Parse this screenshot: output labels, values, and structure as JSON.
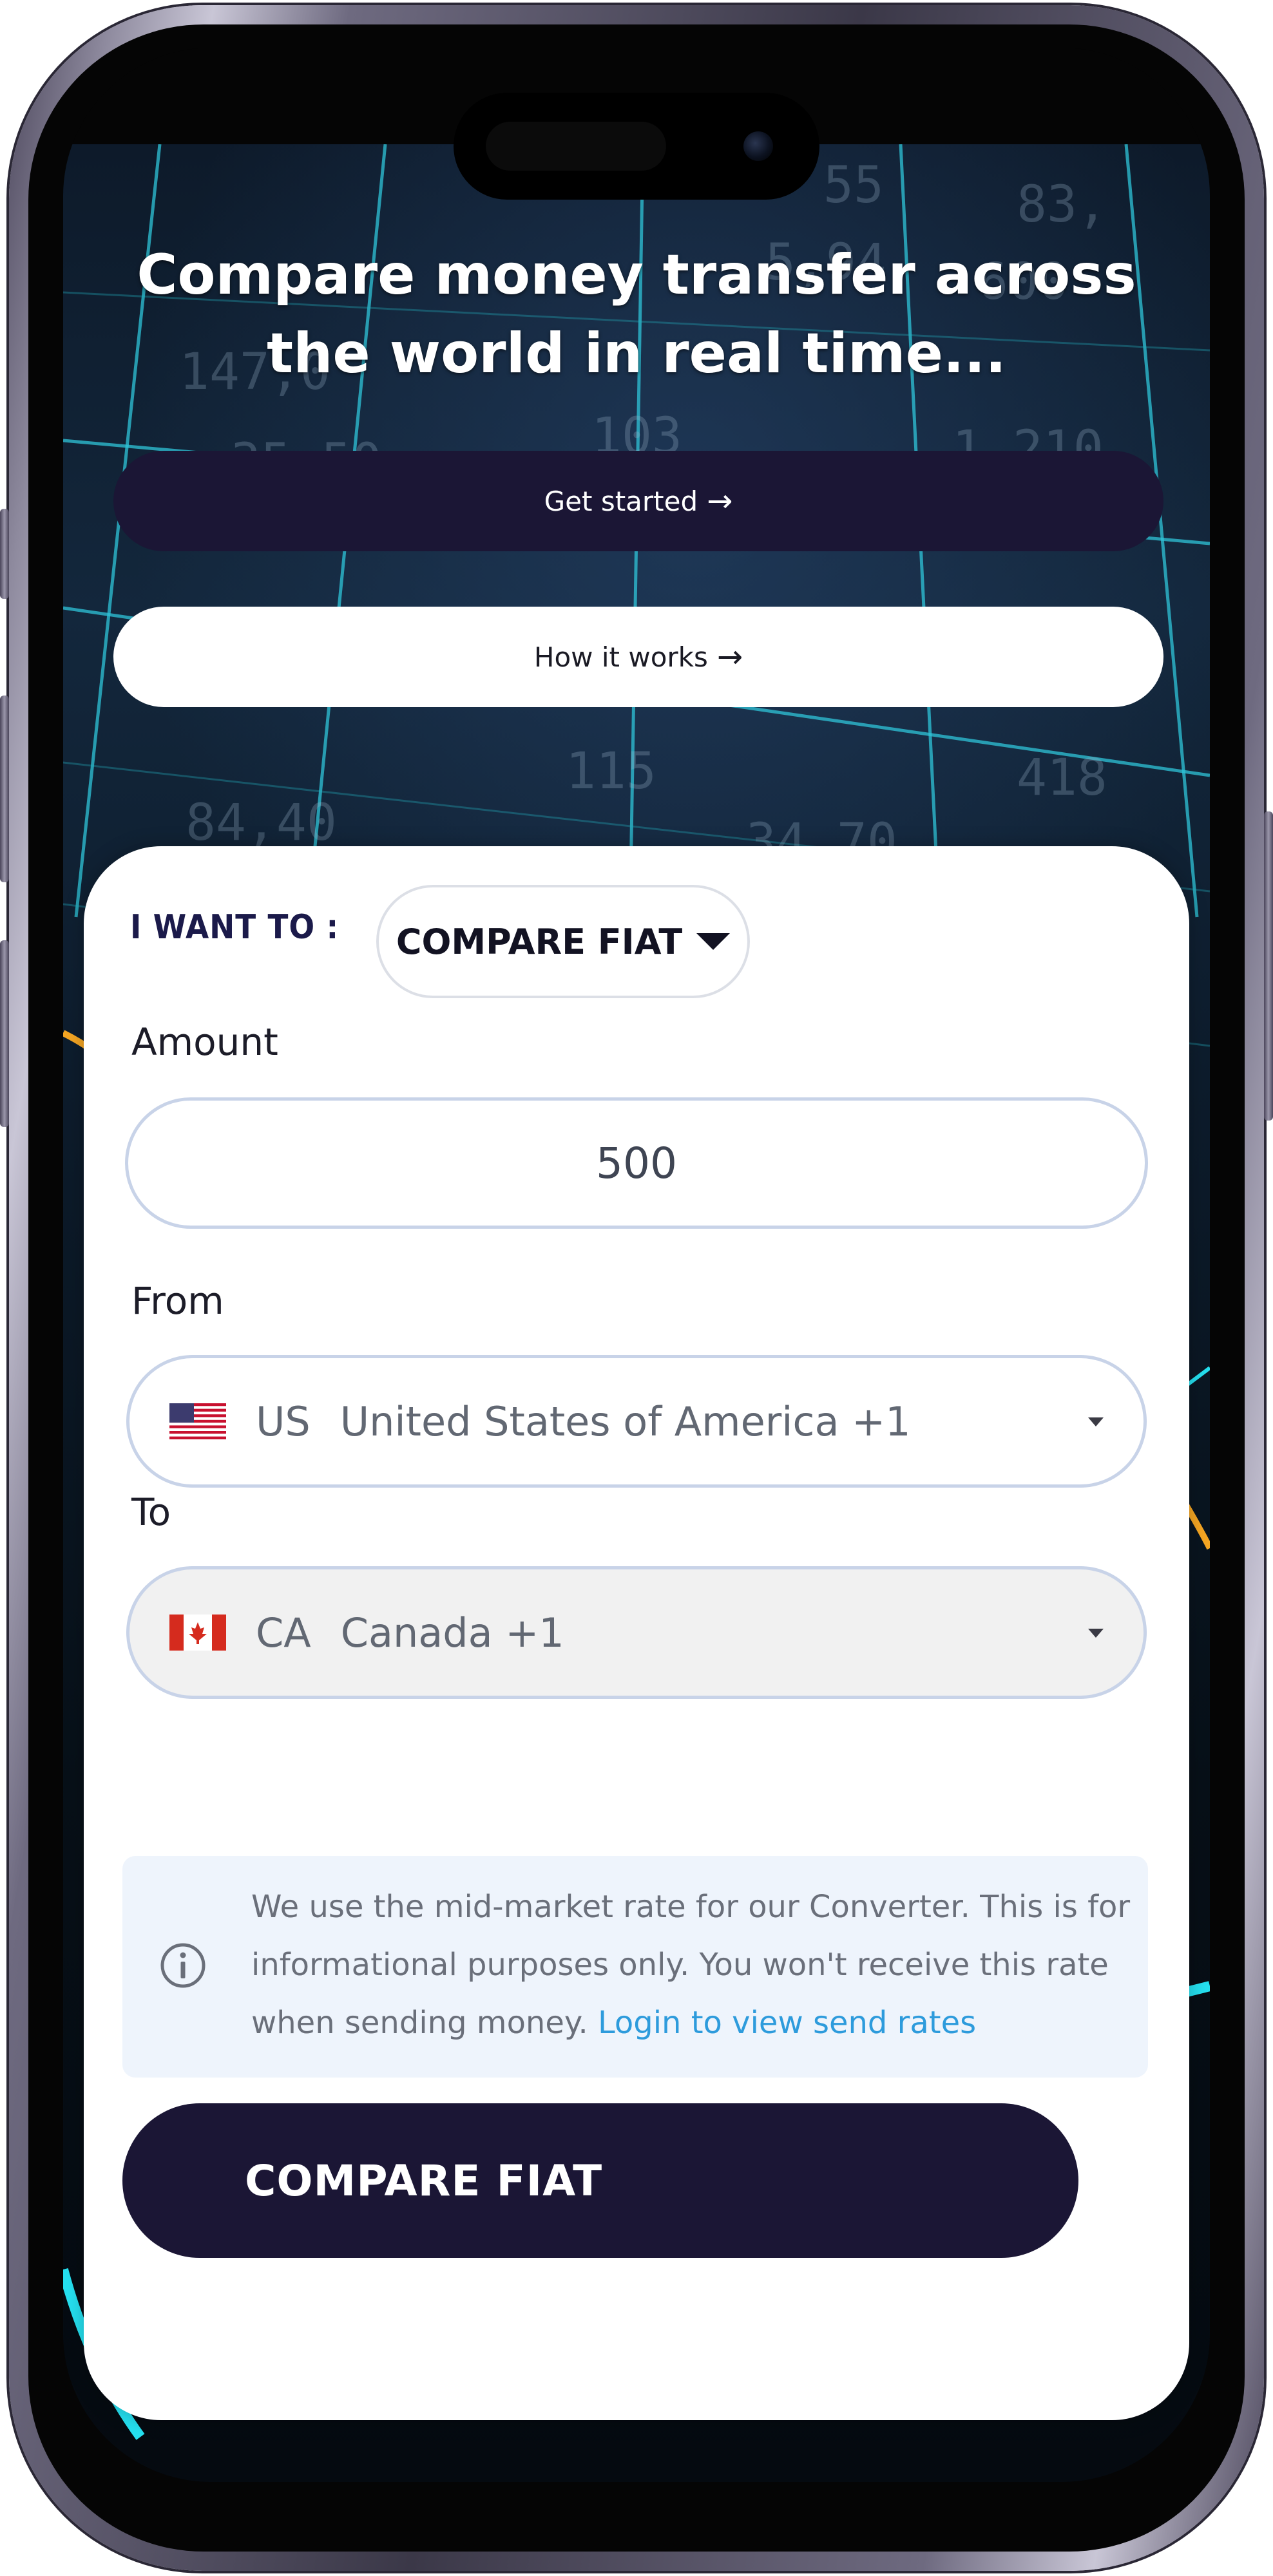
{
  "hero": {
    "headline": "Compare money transfer across the world in real time...",
    "get_started_label": "Get started",
    "how_it_works_label": "How it works"
  },
  "converter": {
    "mode_label": "I WANT TO :",
    "mode_selected": "COMPARE FIAT",
    "amount_label": "Amount",
    "amount_value": "500",
    "from_label": "From",
    "from_country": {
      "code": "US",
      "name": "United States of America +1",
      "flag": "us-flag-icon"
    },
    "to_label": "To",
    "to_country": {
      "code": "CA",
      "name": "Canada +1",
      "flag": "ca-flag-icon"
    },
    "notice_text": "We use the mid-market rate for our Converter. This is for informational purposes only. You won't receive this rate when sending money.",
    "notice_link": "Login to view send rates",
    "submit_label": "COMPARE FIAT"
  },
  "colors": {
    "primary_dark": "#1b1635",
    "link_blue": "#2d9bdc",
    "notice_bg": "#eef4fc",
    "input_border": "#c8d3e8"
  }
}
